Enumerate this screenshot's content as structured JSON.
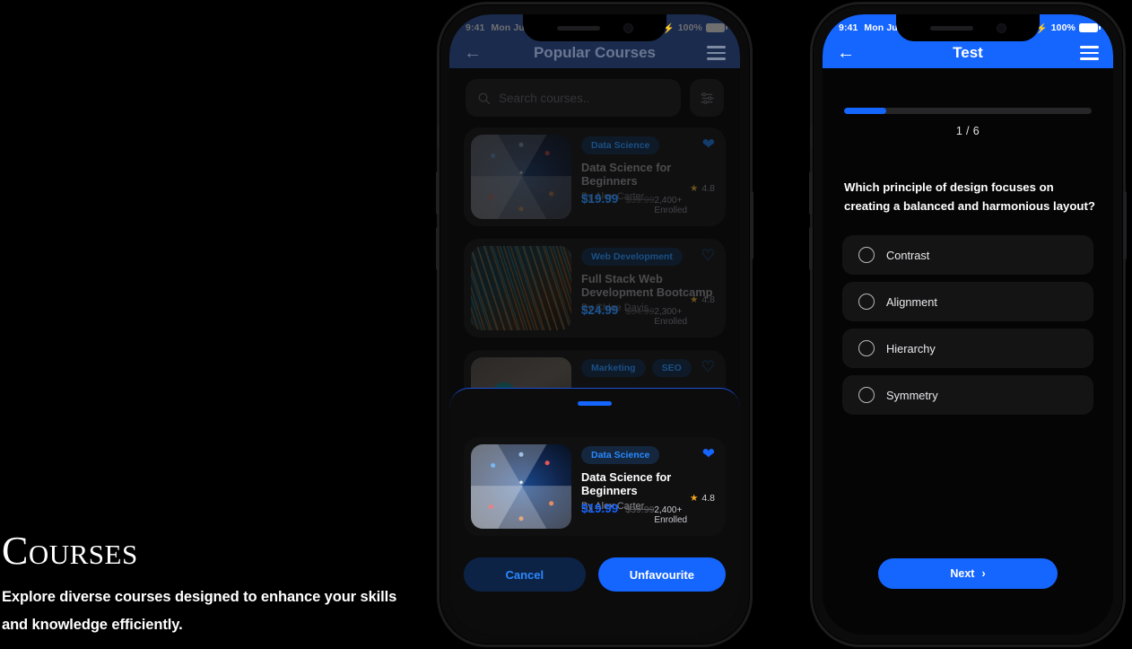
{
  "caption": {
    "title": "Courses",
    "subtitle": "Explore diverse courses designed to enhance your skills and knowledge efficiently."
  },
  "colors": {
    "accent_blue": "#1565ff",
    "accent_blue_light": "#2a89ff",
    "header_blue": "#1565ff",
    "header_blue_dim": "#1b2b4d",
    "star_gold": "#f5a623",
    "screen_black": "#050505",
    "card_black": "#101011"
  },
  "phone1": {
    "status_bar": {
      "time": "9:41",
      "date": "Mon Ju",
      "battery_percent": "100%",
      "wifi_icon": "wifi-icon",
      "battery_icon": "battery-icon"
    },
    "app_bar": {
      "back_icon": "arrow-left-icon",
      "title": "Popular Courses",
      "menu_icon": "hamburger-menu-icon"
    },
    "search": {
      "placeholder": "Search courses..",
      "search_icon": "search-icon",
      "filter_icon": "filter-sliders-icon"
    },
    "courses": [
      {
        "tags": [
          "Data Science"
        ],
        "title": "Data Science for Beginners",
        "author": "By Alex Carter",
        "rating": "4.8",
        "price": "$19.99",
        "old_price": "$39.99",
        "enrolled": "2,400+ Enrolled",
        "favourite": true,
        "thumb_class": "tb-datasci"
      },
      {
        "tags": [
          "Web Development"
        ],
        "title": "Full Stack Web Development Bootcamp",
        "author": "By Chloe Davis",
        "rating": "4.8",
        "price": "$24.99",
        "old_price": "$54.99",
        "enrolled": "2,300+ Enrolled",
        "favourite": false,
        "thumb_class": "tb-web"
      },
      {
        "tags": [
          "Marketing",
          "SEO"
        ],
        "title": "",
        "author": "",
        "rating": "",
        "price": "",
        "old_price": "",
        "enrolled": "",
        "favourite": false,
        "thumb_class": "tb-mkt"
      }
    ],
    "sheet": {
      "handle": "drag-handle",
      "course": {
        "tags": [
          "Data Science"
        ],
        "title": "Data Science for Beginners",
        "author": "By Alex Carter",
        "rating": "4.8",
        "price": "$19.99",
        "old_price": "$39.99",
        "enrolled": "2,400+ Enrolled",
        "favourite": true,
        "thumb_class": "tb-datasci"
      },
      "cancel_label": "Cancel",
      "confirm_label": "Unfavourite"
    }
  },
  "phone2": {
    "status_bar": {
      "time": "9:41",
      "date": "Mon Ju",
      "battery_percent": "100%",
      "wifi_icon": "wifi-icon",
      "battery_icon": "battery-icon"
    },
    "app_bar": {
      "back_icon": "arrow-left-icon",
      "title": "Test",
      "menu_icon": "hamburger-menu-icon"
    },
    "progress": {
      "label": "1 / 6",
      "percent": 17
    },
    "question": "Which principle of design focuses on creating a balanced and harmonious layout?",
    "options": [
      {
        "label": "Contrast",
        "selected": false
      },
      {
        "label": "Alignment",
        "selected": false
      },
      {
        "label": "Hierarchy",
        "selected": false
      },
      {
        "label": "Symmetry",
        "selected": false
      }
    ],
    "next_label": "Next",
    "next_icon": "chevron-right-icon"
  }
}
